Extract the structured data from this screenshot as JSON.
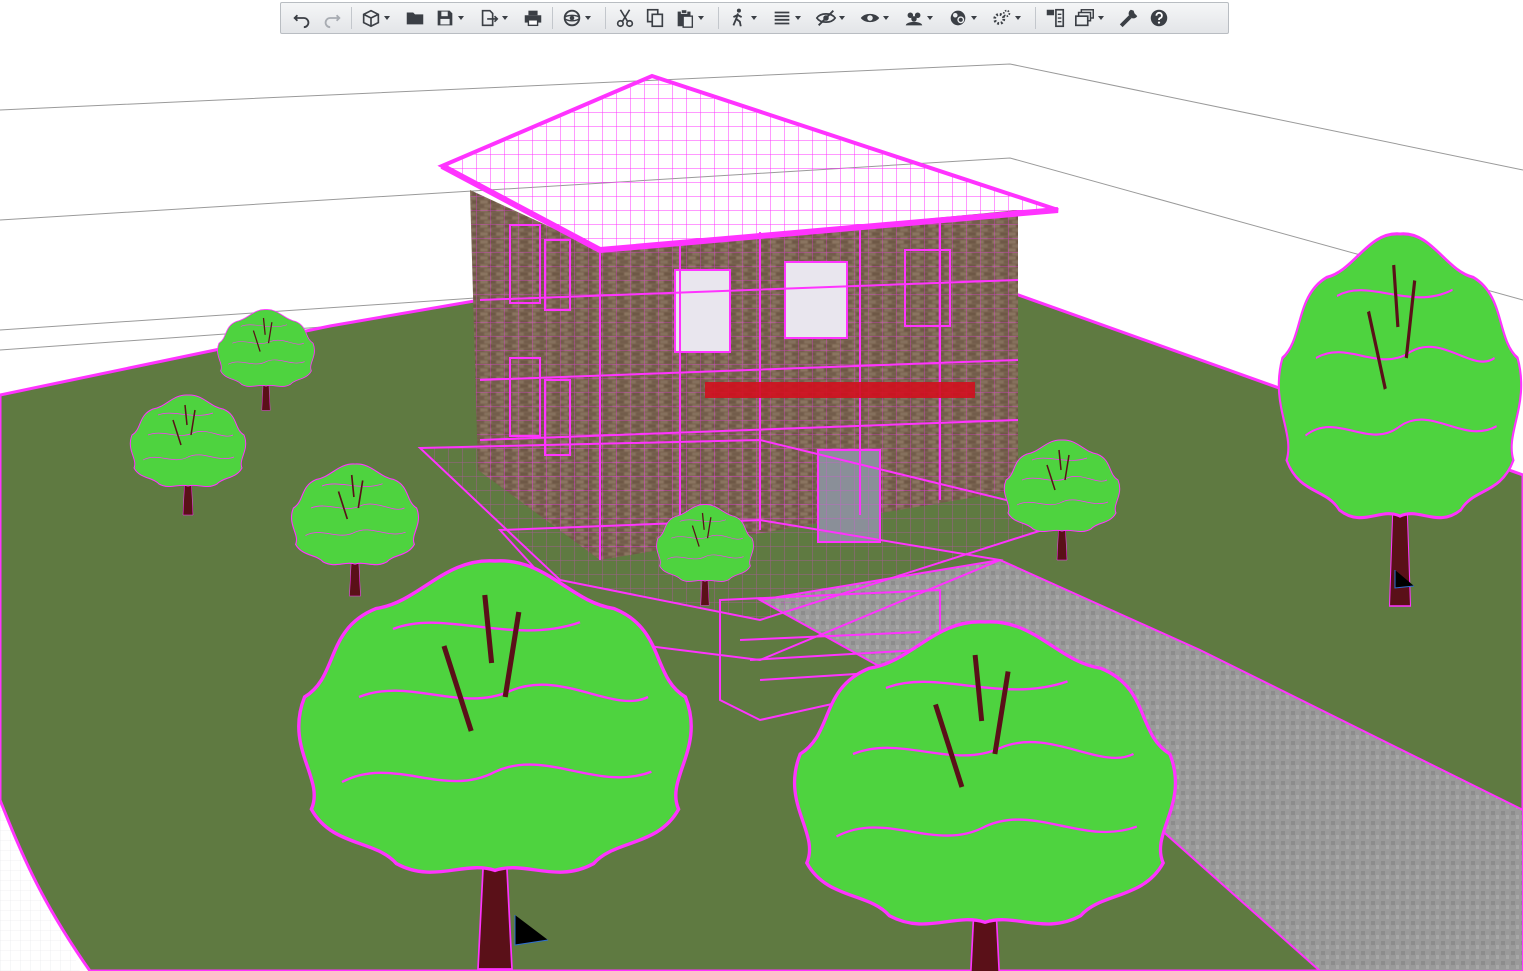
{
  "window": {
    "type": "3D model viewport"
  },
  "colors": {
    "ground": "#5f7a41",
    "tree_fill": "#4ed33f",
    "selection": "#ff33ff",
    "trunk": "#5a1018",
    "brick": "#7a6350",
    "path": "#9a9a9a",
    "toolbar_bg": "#eceef0",
    "icon": "#3b3f45"
  },
  "toolbar": {
    "buttons": [
      {
        "name": "undo",
        "icon": "undo-icon"
      },
      {
        "name": "redo",
        "icon": "redo-icon",
        "disabled": true
      },
      {
        "name": "new-3d-view",
        "icon": "cube-icon",
        "dropdown": true
      },
      {
        "name": "open",
        "icon": "folder-icon"
      },
      {
        "name": "save",
        "icon": "save-icon",
        "dropdown": true
      },
      {
        "name": "export",
        "icon": "export-icon",
        "dropdown": true
      },
      {
        "name": "print",
        "icon": "print-icon"
      },
      {
        "name": "orbit",
        "icon": "orbit-icon",
        "dropdown": true
      },
      {
        "name": "cut",
        "icon": "scissors-icon"
      },
      {
        "name": "copy",
        "icon": "copy-icon"
      },
      {
        "name": "paste",
        "icon": "paste-icon",
        "dropdown": true
      },
      {
        "name": "walk",
        "icon": "walk-icon",
        "dropdown": true
      },
      {
        "name": "layers",
        "icon": "list-icon",
        "dropdown": true
      },
      {
        "name": "hide",
        "icon": "eye-off-icon",
        "dropdown": true
      },
      {
        "name": "show",
        "icon": "eye-icon",
        "dropdown": true
      },
      {
        "name": "isolate",
        "icon": "group-icon",
        "dropdown": true
      },
      {
        "name": "render",
        "icon": "render-icon",
        "dropdown": true
      },
      {
        "name": "settings",
        "icon": "gears-icon",
        "dropdown": true
      },
      {
        "name": "tile-windows",
        "icon": "windows-icon"
      },
      {
        "name": "stack-windows",
        "icon": "stack-icon",
        "dropdown": true
      },
      {
        "name": "tools",
        "icon": "wrench-icon"
      },
      {
        "name": "help",
        "icon": "help-icon"
      }
    ]
  }
}
